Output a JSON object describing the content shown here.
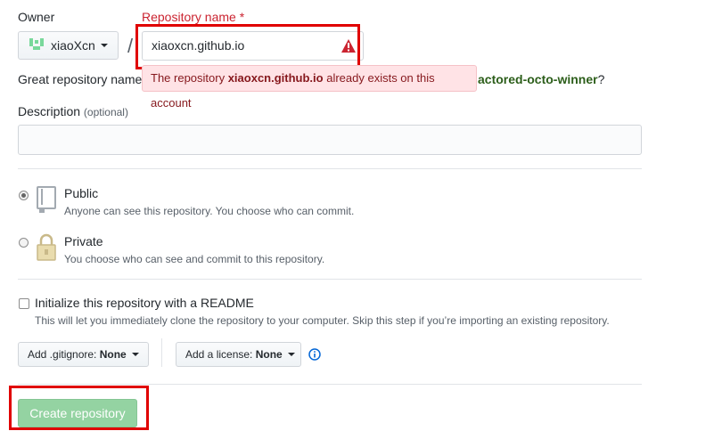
{
  "owner": {
    "label": "Owner",
    "value": "xiaoXcn"
  },
  "repo": {
    "label": "Repository name",
    "required_mark": "*",
    "value": "xiaoxcn.github.io",
    "error_prefix": "The repository ",
    "error_name": "xiaoxcn.github.io",
    "error_suffix": " already exists on this account",
    "suggestion_prefix": "Great repository name",
    "suggestion_name": "actored-octo-winner",
    "suggestion_suffix": "?"
  },
  "description": {
    "label": "Description",
    "optional": "(optional)",
    "value": ""
  },
  "visibility": {
    "public": {
      "title": "Public",
      "note": "Anyone can see this repository. You choose who can commit.",
      "selected": true
    },
    "private": {
      "title": "Private",
      "note": "You choose who can see and commit to this repository.",
      "selected": false
    }
  },
  "init": {
    "title": "Initialize this repository with a README",
    "note": "This will let you immediately clone the repository to your computer. Skip this step if you’re importing an existing repository.",
    "checked": false
  },
  "gitignore": {
    "label": "Add .gitignore:",
    "value": "None"
  },
  "license": {
    "label": "Add a license:",
    "value": "None"
  },
  "create_button": "Create repository",
  "colors": {
    "error_red": "#cb2431",
    "create_green": "#94d3a2",
    "highlight_red": "#e00000"
  }
}
